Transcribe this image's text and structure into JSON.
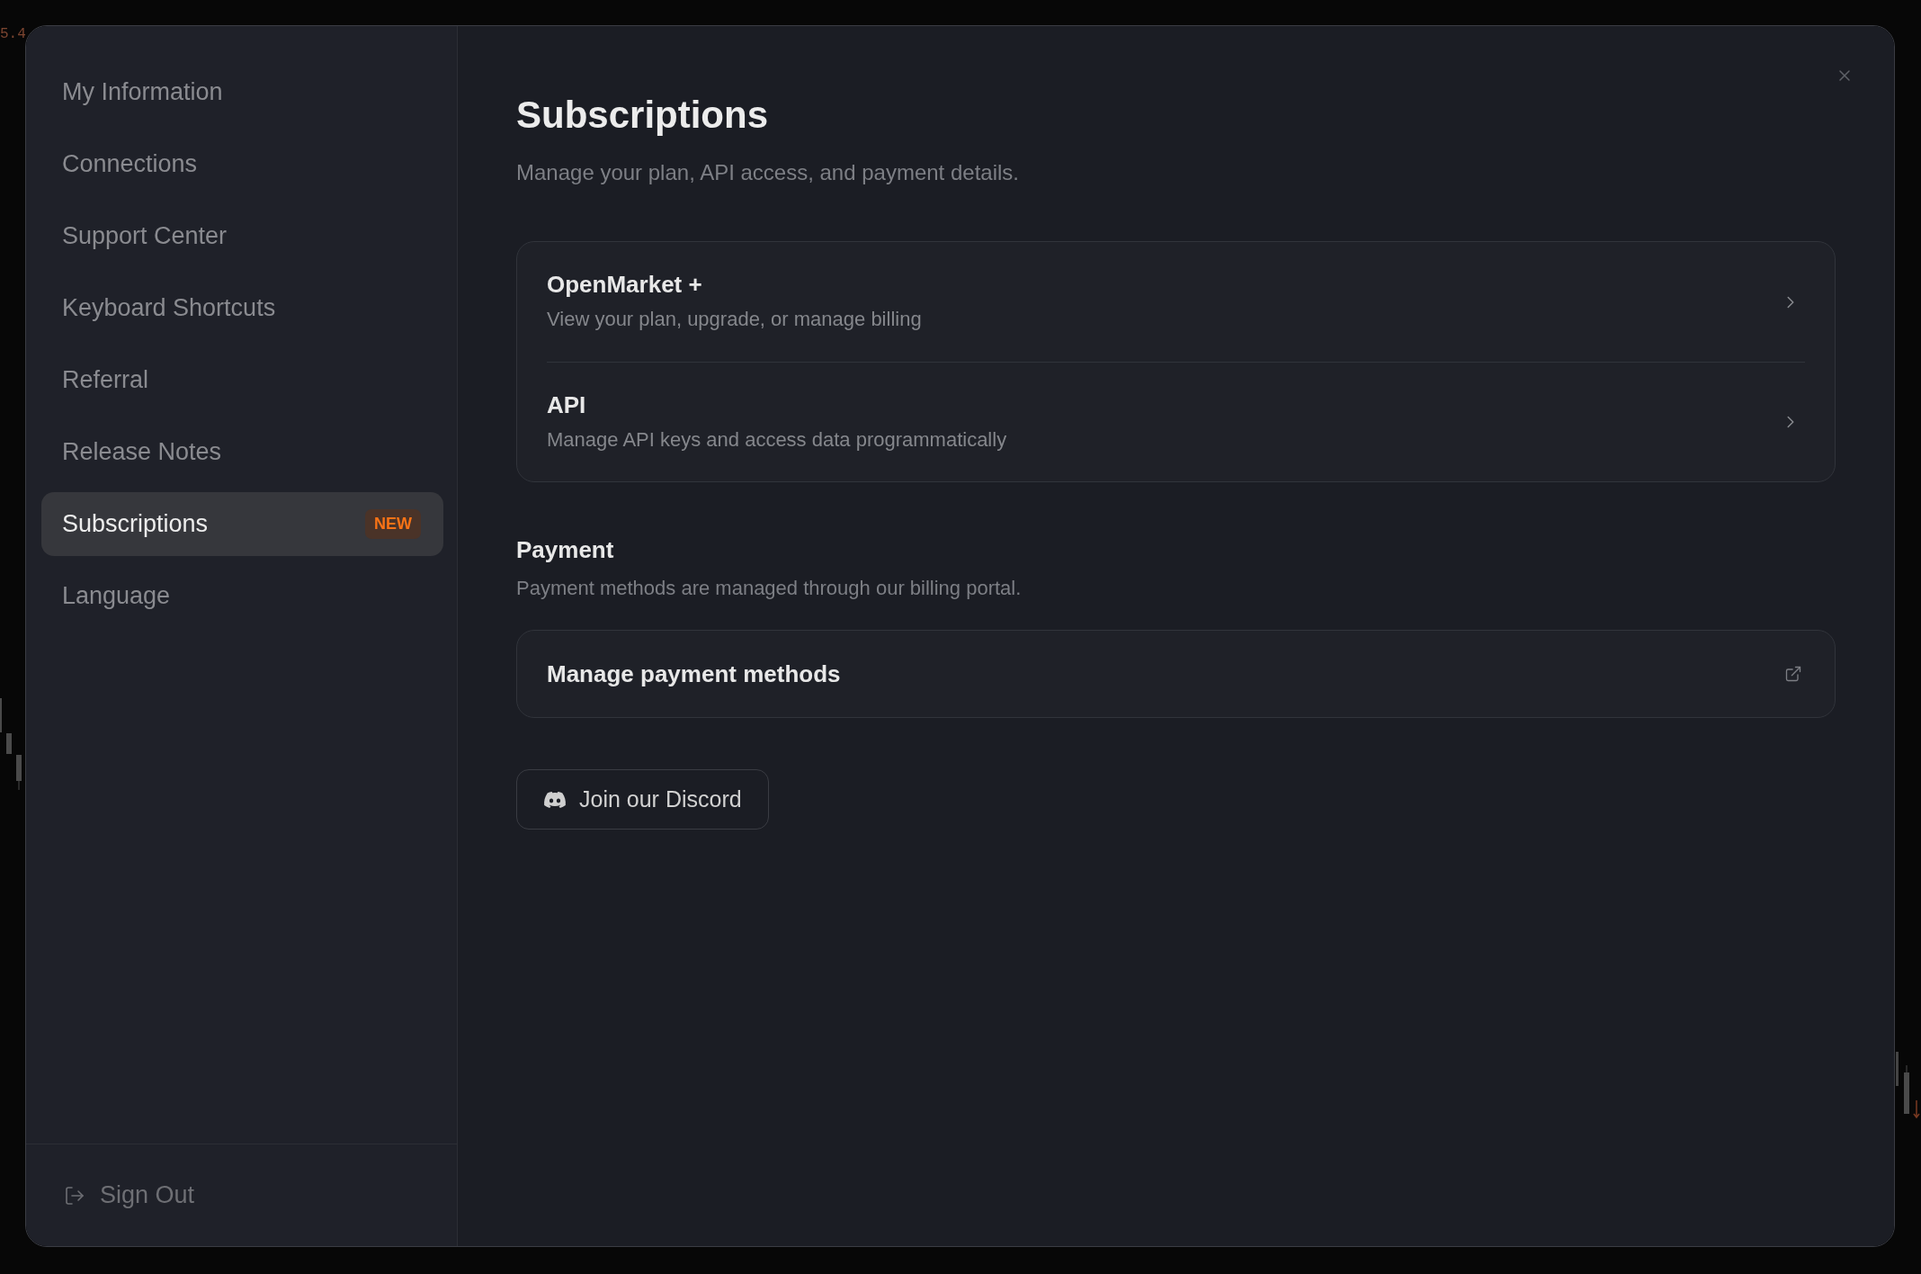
{
  "background": {
    "price_label": "5.4"
  },
  "sidebar": {
    "items": [
      {
        "label": "My Information",
        "selected": false
      },
      {
        "label": "Connections",
        "selected": false
      },
      {
        "label": "Support Center",
        "selected": false
      },
      {
        "label": "Keyboard Shortcuts",
        "selected": false
      },
      {
        "label": "Referral",
        "selected": false
      },
      {
        "label": "Release Notes",
        "selected": false
      },
      {
        "label": "Subscriptions",
        "selected": true,
        "badge": "NEW"
      },
      {
        "label": "Language",
        "selected": false
      }
    ],
    "sign_out": {
      "label": "Sign Out"
    }
  },
  "main": {
    "title": "Subscriptions",
    "subtitle": "Manage your plan, API access, and payment details.",
    "plan_links": [
      {
        "title": "OpenMarket +",
        "description": "View your plan, upgrade, or manage billing"
      },
      {
        "title": "API",
        "description": "Manage API keys and access data programmatically"
      }
    ],
    "payment": {
      "heading": "Payment",
      "description": "Payment methods are managed through our billing portal.",
      "link": {
        "label": "Manage payment methods"
      }
    },
    "discord_button": {
      "label": "Join our Discord"
    }
  }
}
